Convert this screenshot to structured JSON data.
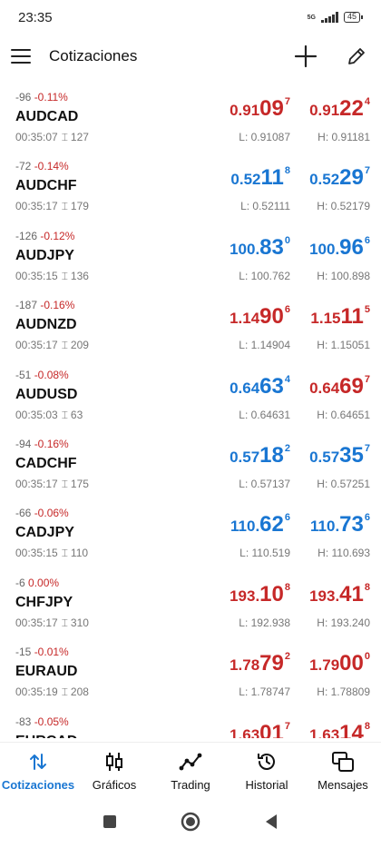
{
  "status": {
    "time": "23:35",
    "network": "5G",
    "battery": "45"
  },
  "header": {
    "title": "Cotizaciones",
    "add_icon": "plus-icon",
    "edit_icon": "pencil-icon"
  },
  "colors": {
    "accent": "#1976d2",
    "down": "#c62828",
    "up": "#1976d2"
  },
  "quotes": [
    {
      "change": "-96",
      "pct": "-0.11%",
      "symbol": "AUDCAD",
      "time": "00:35:07",
      "spread": "127",
      "bid": {
        "small": "0.91",
        "big": "09",
        "sup": "7",
        "dir": "down"
      },
      "ask": {
        "small": "0.91",
        "big": "22",
        "sup": "4",
        "dir": "down"
      },
      "low": "L: 0.91087",
      "high": "H: 0.91181"
    },
    {
      "change": "-72",
      "pct": "-0.14%",
      "symbol": "AUDCHF",
      "time": "00:35:17",
      "spread": "179",
      "bid": {
        "small": "0.52",
        "big": "11",
        "sup": "8",
        "dir": "up"
      },
      "ask": {
        "small": "0.52",
        "big": "29",
        "sup": "7",
        "dir": "up"
      },
      "low": "L: 0.52111",
      "high": "H: 0.52179"
    },
    {
      "change": "-126",
      "pct": "-0.12%",
      "symbol": "AUDJPY",
      "time": "00:35:15",
      "spread": "136",
      "bid": {
        "small": "100.",
        "big": "83",
        "sup": "0",
        "dir": "up"
      },
      "ask": {
        "small": "100.",
        "big": "96",
        "sup": "6",
        "dir": "up"
      },
      "low": "L: 100.762",
      "high": "H: 100.898"
    },
    {
      "change": "-187",
      "pct": "-0.16%",
      "symbol": "AUDNZD",
      "time": "00:35:17",
      "spread": "209",
      "bid": {
        "small": "1.14",
        "big": "90",
        "sup": "6",
        "dir": "down"
      },
      "ask": {
        "small": "1.15",
        "big": "11",
        "sup": "5",
        "dir": "down"
      },
      "low": "L: 1.14904",
      "high": "H: 1.15051"
    },
    {
      "change": "-51",
      "pct": "-0.08%",
      "symbol": "AUDUSD",
      "time": "00:35:03",
      "spread": "63",
      "bid": {
        "small": "0.64",
        "big": "63",
        "sup": "4",
        "dir": "up"
      },
      "ask": {
        "small": "0.64",
        "big": "69",
        "sup": "7",
        "dir": "down"
      },
      "low": "L: 0.64631",
      "high": "H: 0.64651"
    },
    {
      "change": "-94",
      "pct": "-0.16%",
      "symbol": "CADCHF",
      "time": "00:35:17",
      "spread": "175",
      "bid": {
        "small": "0.57",
        "big": "18",
        "sup": "2",
        "dir": "up"
      },
      "ask": {
        "small": "0.57",
        "big": "35",
        "sup": "7",
        "dir": "up"
      },
      "low": "L: 0.57137",
      "high": "H: 0.57251"
    },
    {
      "change": "-66",
      "pct": "-0.06%",
      "symbol": "CADJPY",
      "time": "00:35:15",
      "spread": "110",
      "bid": {
        "small": "110.",
        "big": "62",
        "sup": "6",
        "dir": "up"
      },
      "ask": {
        "small": "110.",
        "big": "73",
        "sup": "6",
        "dir": "up"
      },
      "low": "L: 110.519",
      "high": "H: 110.693"
    },
    {
      "change": "-6",
      "pct": "0.00%",
      "symbol": "CHFJPY",
      "time": "00:35:17",
      "spread": "310",
      "bid": {
        "small": "193.",
        "big": "10",
        "sup": "8",
        "dir": "down"
      },
      "ask": {
        "small": "193.",
        "big": "41",
        "sup": "8",
        "dir": "down"
      },
      "low": "L: 192.938",
      "high": "H: 193.240"
    },
    {
      "change": "-15",
      "pct": "-0.01%",
      "symbol": "EURAUD",
      "time": "00:35:19",
      "spread": "208",
      "bid": {
        "small": "1.78",
        "big": "79",
        "sup": "2",
        "dir": "down"
      },
      "ask": {
        "small": "1.79",
        "big": "00",
        "sup": "0",
        "dir": "down"
      },
      "low": "L: 1.78747",
      "high": "H: 1.78809"
    },
    {
      "change": "-83",
      "pct": "-0.05%",
      "symbol": "EURCAD",
      "time": "",
      "spread": "",
      "bid": {
        "small": "1.63",
        "big": "01",
        "sup": "7",
        "dir": "down"
      },
      "ask": {
        "small": "1.63",
        "big": "14",
        "sup": "8",
        "dir": "down"
      },
      "low": "",
      "high": ""
    }
  ],
  "bottom_nav": [
    {
      "label": "Cotizaciones",
      "icon": "quotes-arrows-icon",
      "active": true
    },
    {
      "label": "Gráficos",
      "icon": "candlestick-chart-icon",
      "active": false
    },
    {
      "label": "Trading",
      "icon": "trading-line-icon",
      "active": false
    },
    {
      "label": "Historial",
      "icon": "history-clock-icon",
      "active": false
    },
    {
      "label": "Mensajes",
      "icon": "messages-icon",
      "active": false
    }
  ],
  "system_nav": [
    "recents-square-icon",
    "home-circle-icon",
    "back-triangle-icon"
  ]
}
